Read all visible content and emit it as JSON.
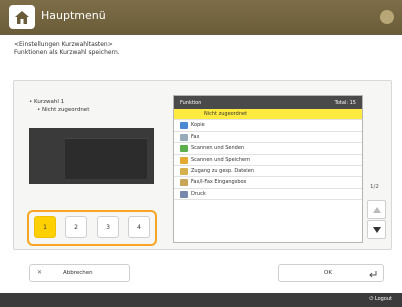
{
  "header": {
    "title": "Hauptmenü"
  },
  "description": {
    "line1": "<Einstellungen Kurzwahltasten>",
    "line2": "Funktionen als Kurzwahl speichern."
  },
  "dial": {
    "label": "Kurzwahl 1",
    "value": "Nicht zugeordnet"
  },
  "numbers": [
    "1",
    "2",
    "3",
    "4"
  ],
  "list": {
    "head_left": "Funktion",
    "head_right": "Total: 15",
    "items": [
      "Nicht zugeordnet",
      "Kopie",
      "Fax",
      "Scannen und Senden",
      "Scannen und Speichern",
      "Zugang zu gesp. Dateien",
      "Fax/I-Fax Eingangsbox",
      "Druck"
    ]
  },
  "page": "1/2",
  "buttons": {
    "cancel": "Abbrechen",
    "ok": "OK"
  },
  "footer": {
    "logout": "Logout"
  },
  "colors": {
    "header": "#6f603d",
    "selected": "#ffea40",
    "highlight": "#f6a623"
  }
}
